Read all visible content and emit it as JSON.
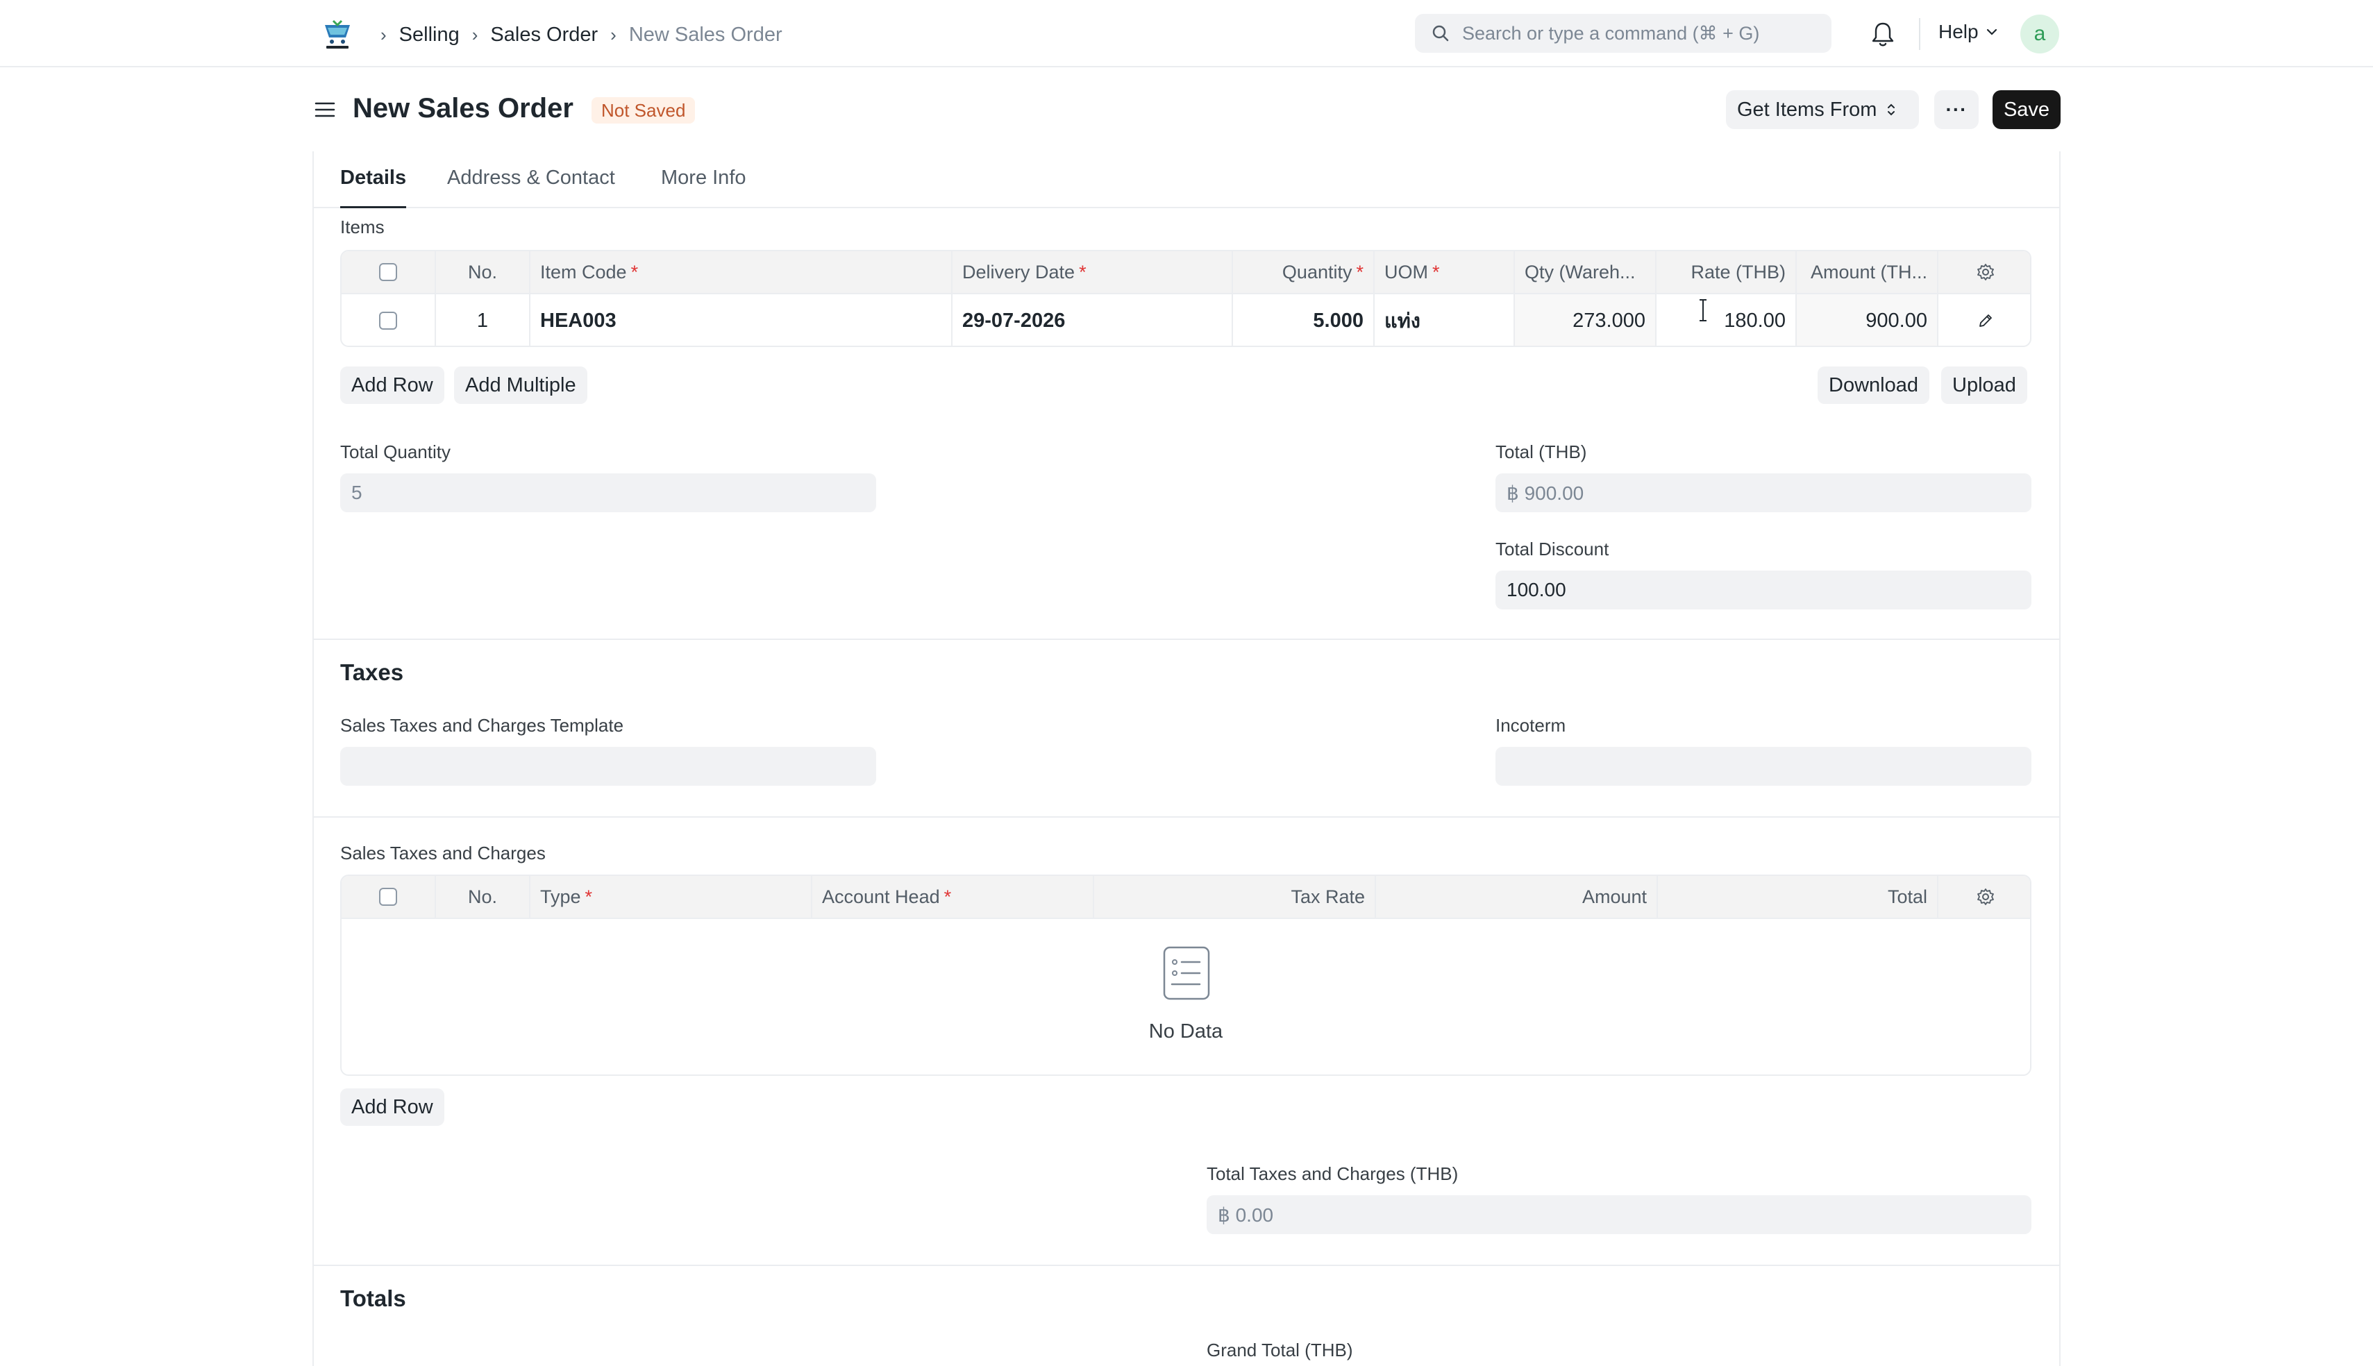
{
  "navbar": {
    "breadcrumbs": [
      "Selling",
      "Sales Order",
      "New Sales Order"
    ],
    "search_placeholder": "Search or type a command (⌘ + G)",
    "help_label": "Help",
    "avatar_letter": "a"
  },
  "page": {
    "title": "New Sales Order",
    "status": "Not Saved",
    "get_items_label": "Get Items From",
    "more_label": "···",
    "save_label": "Save"
  },
  "tabs": [
    "Details",
    "Address & Contact",
    "More Info"
  ],
  "items": {
    "section_label": "Items",
    "columns": [
      "No.",
      "Item Code",
      "Delivery Date",
      "Quantity",
      "UOM",
      "Qty (Wareh...",
      "Rate (THB)",
      "Amount (TH..."
    ],
    "rows": [
      {
        "no": "1",
        "item_code": "HEA003",
        "delivery_date": "29-07-2026",
        "quantity": "5.000",
        "uom": "แท่ง",
        "qty_warehouse": "273.000",
        "rate": "180.00",
        "amount": "900.00"
      }
    ],
    "add_row_label": "Add Row",
    "add_multiple_label": "Add Multiple",
    "download_label": "Download",
    "upload_label": "Upload"
  },
  "totals_block": {
    "total_quantity_label": "Total Quantity",
    "total_quantity_value": "5",
    "total_label": "Total (THB)",
    "total_value": "฿ 900.00",
    "total_discount_label": "Total Discount",
    "total_discount_value": "100.00"
  },
  "taxes": {
    "section_title": "Taxes",
    "template_label": "Sales Taxes and Charges Template",
    "template_value": "",
    "incoterm_label": "Incoterm",
    "incoterm_value": "",
    "table_label": "Sales Taxes and Charges",
    "columns": [
      "No.",
      "Type",
      "Account Head",
      "Tax Rate",
      "Amount",
      "Total"
    ],
    "no_data_label": "No Data",
    "add_row_label": "Add Row",
    "total_taxes_label": "Total Taxes and Charges (THB)",
    "total_taxes_value": "฿ 0.00"
  },
  "totals": {
    "section_title": "Totals",
    "grand_total_label": "Grand Total (THB)"
  },
  "colors": {
    "save_bg": "#171717",
    "badge_bg": "#fff1e7",
    "badge_text": "#c0562b",
    "required": "#e03636",
    "avatar_bg": "#dcf3e4",
    "avatar_text": "#2e9c57"
  }
}
